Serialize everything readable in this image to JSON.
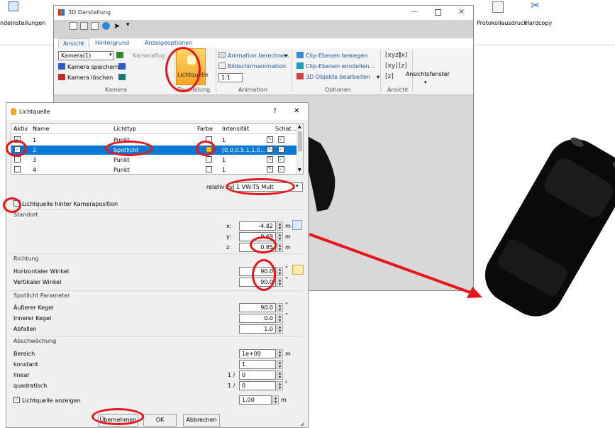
{
  "main_app": {
    "left_label": "ndeinstellungen",
    "right_buttons": [
      "Protokollausdruck",
      "Hardcopy"
    ]
  },
  "darstellung": {
    "title": "3D Darstellung",
    "tabs": [
      "Ansicht",
      "Hintergrund",
      "Anzeigeoptionen"
    ],
    "camera_select": "Kamera(1)",
    "camera_flight": "Kameraflug",
    "camera_save": "Kamera speichern",
    "camera_delete": "Kamera löschen",
    "group_kamera": "Kamera",
    "light_button": "Lichtquelle",
    "group_darstellung": "Darstellung",
    "anim_calc": "Animation berechnen",
    "anim_frame": "Bildschirmanimation",
    "anim_ratio": "1:1",
    "group_animation": "Animation",
    "clip_move": "Clip-Ebenen bewegen",
    "clip_set": "Clip-Ebenen einstellen...",
    "edit_3d": "3D Objekte bearbeiten",
    "group_optionen": "Optionen",
    "group_ansicht": "Ansicht",
    "view_window": "Ansichtsfenster"
  },
  "dialog": {
    "title": "Lichtquelle",
    "help": "?",
    "close": "✕",
    "columns": [
      "Aktiv",
      "Name",
      "Lichttyp",
      "Farbe",
      "Intensität",
      "Schat..."
    ],
    "rows": [
      {
        "name": "1",
        "type": "Punkt",
        "intensity": "1"
      },
      {
        "name": "2",
        "type": "Spotlicht",
        "intensity": "[0,0,0.5,1,1,0,..."
      },
      {
        "name": "3",
        "type": "Punkt",
        "intensity": "1"
      },
      {
        "name": "4",
        "type": "Punkt",
        "intensity": "1"
      }
    ],
    "relativ_label": "relativ zu:",
    "relativ_value": "1 VW-T5 Mult",
    "behind_camera": "Lichtquelle hinter Kameraposition",
    "standort": "Standort",
    "x_label": "x:",
    "y_label": "y:",
    "z_label": "z:",
    "x": "-4.82",
    "y": "0.69",
    "z": "0.85",
    "unit_m": "m",
    "richtung": "Richtung",
    "h_angle_label": "Horizontaler Winkel",
    "v_angle_label": "Vertikaler Winkel",
    "h_angle": "90.0",
    "v_angle": "90.0",
    "deg": "°",
    "spot_params": "Spotlicht Parameter",
    "outer_label": "Äußerer Kegel",
    "inner_label": "Innerer Kegel",
    "falloff_label": "Abfallen",
    "outer": "90.0",
    "inner": "0.0",
    "falloff": "1.0",
    "attenuation": "Abschwächung",
    "range_label": "Bereich",
    "const_label": "konstant",
    "linear_label": "linear",
    "quad_label": "quadratisch",
    "range": "1e+09",
    "const": "1",
    "linear": "0",
    "quad": "0",
    "one_over": "1 /",
    "squared": "²",
    "show_light": "Lichtquelle anzeigen",
    "show_value": "1.00",
    "apply": "Übernehmen",
    "ok": "OK",
    "cancel": "Abbrechen"
  }
}
